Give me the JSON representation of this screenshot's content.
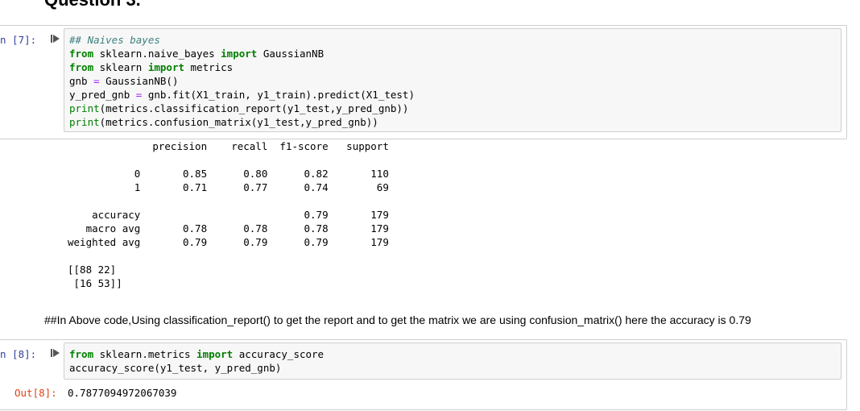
{
  "heading": "Question 3.",
  "cell7": {
    "prompt": "n [7]:",
    "code_lines": [
      {
        "parts": [
          {
            "t": "## Naives bayes",
            "c": "cm"
          }
        ]
      },
      {
        "parts": [
          {
            "t": "from",
            "c": "kw"
          },
          {
            "t": " sklearn.naive_bayes ",
            "c": ""
          },
          {
            "t": "import",
            "c": "kw"
          },
          {
            "t": " GaussianNB",
            "c": ""
          }
        ]
      },
      {
        "parts": [
          {
            "t": "from",
            "c": "kw"
          },
          {
            "t": " sklearn ",
            "c": ""
          },
          {
            "t": "import",
            "c": "kw"
          },
          {
            "t": " metrics",
            "c": ""
          }
        ]
      },
      {
        "parts": [
          {
            "t": "gnb ",
            "c": ""
          },
          {
            "t": "=",
            "c": "op"
          },
          {
            "t": " GaussianNB()",
            "c": ""
          }
        ]
      },
      {
        "parts": [
          {
            "t": "y_pred_gnb ",
            "c": ""
          },
          {
            "t": "=",
            "c": "op"
          },
          {
            "t": " gnb.fit(X1_train, y1_train).predict(X1_test)",
            "c": ""
          }
        ]
      },
      {
        "parts": [
          {
            "t": "print",
            "c": "bi"
          },
          {
            "t": "(metrics.classification_report(y1_test,y_pred_gnb))",
            "c": ""
          }
        ]
      },
      {
        "parts": [
          {
            "t": "print",
            "c": "bi"
          },
          {
            "t": "(metrics.confusion_matrix(y1_test,y_pred_gnb))",
            "c": ""
          }
        ]
      }
    ],
    "output": "              precision    recall  f1-score   support\n\n           0       0.85      0.80      0.82       110\n           1       0.71      0.77      0.74        69\n\n    accuracy                           0.79       179\n   macro avg       0.78      0.78      0.78       179\nweighted avg       0.79      0.79      0.79       179\n\n[[88 22]\n [16 53]]"
  },
  "markdown_text": "##In Above code,Using classification_report() to get the report and to get the matrix we are using confusion_matrix() here the accuracy is 0.79",
  "cell8": {
    "prompt": "n [8]:",
    "code_lines": [
      {
        "parts": [
          {
            "t": "from",
            "c": "kw"
          },
          {
            "t": " sklearn.metrics ",
            "c": ""
          },
          {
            "t": "import",
            "c": "kw"
          },
          {
            "t": " accuracy_score",
            "c": ""
          }
        ]
      },
      {
        "parts": [
          {
            "t": "accuracy_score(y1_test, y_pred_gnb)",
            "c": ""
          }
        ]
      }
    ],
    "out_prompt": "Out[8]:",
    "output": "0.7877094972067039"
  },
  "colors": {
    "keyword": "#008000",
    "comment": "#408080",
    "operator": "#aa22ff",
    "prompt_in": "#303f9f",
    "prompt_out": "#d84315"
  }
}
